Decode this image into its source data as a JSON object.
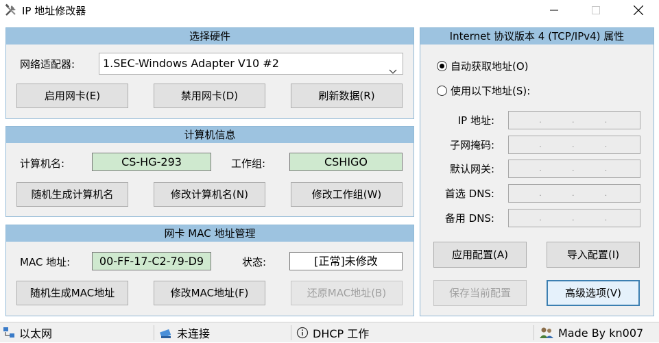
{
  "window": {
    "title": "IP 地址修改器"
  },
  "hardware": {
    "header": "选择硬件",
    "adapter_label": "网络适配器:",
    "adapter_value": "1.SEC-Windows Adapter V10 #2",
    "enable_button": "启用网卡(E)",
    "disable_button": "禁用网卡(D)",
    "refresh_button": "刷新数据(R)"
  },
  "computer": {
    "header": "计算机信息",
    "name_label": "计算机名:",
    "name_value": "CS-HG-293",
    "workgroup_label": "工作组:",
    "workgroup_value": "CSHIGO",
    "random_name_button": "随机生成计算机名",
    "modify_name_button": "修改计算机名(N)",
    "modify_workgroup_button": "修改工作组(W)"
  },
  "mac": {
    "header": "网卡 MAC 地址管理",
    "address_label": "MAC 地址:",
    "address_value": "00-FF-17-C2-79-D9",
    "status_label": "状态:",
    "status_value": "[正常]未修改",
    "random_button": "随机生成MAC地址",
    "modify_button": "修改MAC地址(F)",
    "restore_button": "还原MAC地址(B)"
  },
  "ipv4": {
    "header": "Internet 协议版本 4 (TCP/IPv4) 属性",
    "auto_option": "自动获取地址(O)",
    "manual_option": "使用以下地址(S):",
    "ip_label": "IP 地址:",
    "mask_label": "子网掩码:",
    "gateway_label": "默认网关:",
    "dns1_label": "首选 DNS:",
    "dns2_label": "备用 DNS:",
    "octet_sep": ".",
    "apply_button": "应用配置(A)",
    "import_button": "导入配置(I)",
    "save_button": "保存当前配置",
    "advanced_button": "高级选项(V)"
  },
  "statusbar": {
    "network": "以太网",
    "connection": "未连接",
    "dhcp": "DHCP 工作",
    "credit": "Made By kn007"
  }
}
